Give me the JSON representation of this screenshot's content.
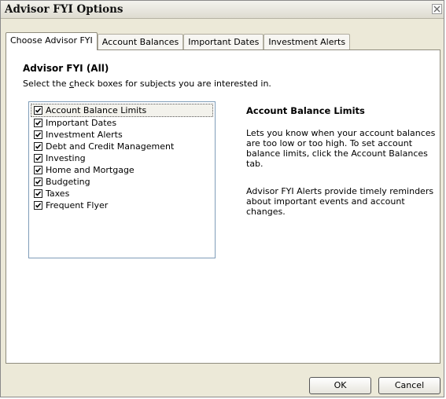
{
  "window": {
    "title": "Advisor FYI Options"
  },
  "tabs": [
    {
      "label": "Choose Advisor FYI",
      "active": true
    },
    {
      "label": "Account Balances",
      "active": false
    },
    {
      "label": "Important Dates",
      "active": false
    },
    {
      "label": "Investment Alerts",
      "active": false
    }
  ],
  "main": {
    "heading": "Advisor FYI (All)",
    "instruction": "Select the check boxes for subjects you are interested in.",
    "subjects": [
      {
        "label": "Account Balance Limits",
        "checked": true
      },
      {
        "label": "Important Dates",
        "checked": true
      },
      {
        "label": "Investment Alerts",
        "checked": true
      },
      {
        "label": "Debt and Credit Management",
        "checked": true
      },
      {
        "label": "Investing",
        "checked": true
      },
      {
        "label": "Home and Mortgage",
        "checked": true
      },
      {
        "label": "Budgeting",
        "checked": true
      },
      {
        "label": "Taxes",
        "checked": true
      },
      {
        "label": "Frequent Flyer",
        "checked": true
      }
    ],
    "detail": {
      "title": "Account Balance Limits",
      "description": "Lets you know when your account balances are too low or too high.  To set account balance limits, click the Account Balances tab.",
      "note": "Advisor FYI Alerts provide timely reminders about important events and account changes."
    }
  },
  "buttons": {
    "ok": "OK",
    "cancel": "Cancel"
  },
  "icons": {
    "close": "close-icon",
    "checkbox": "checkmark-icon"
  }
}
